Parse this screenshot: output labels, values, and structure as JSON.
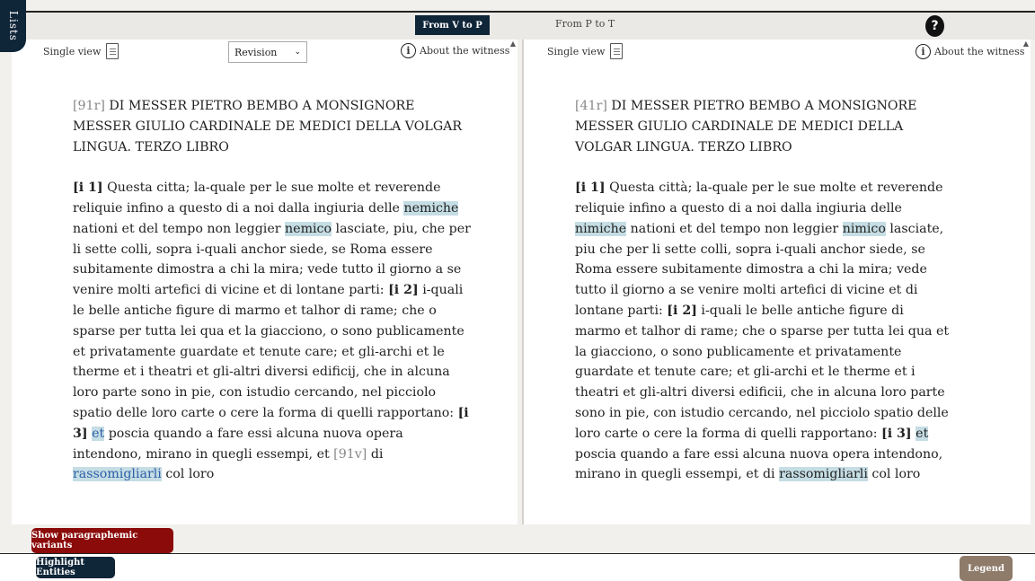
{
  "sidebar": {
    "lists_label": "Lists"
  },
  "header": {
    "tab_v_to_p": "From V to P",
    "tab_p_to_t": "From P to T",
    "help_label": "?"
  },
  "left_panel": {
    "single_view_label": "Single view",
    "revision_value": "Revision",
    "about_label": "About the witness",
    "text": {
      "folio_1": "[91r]",
      "title": " DI MESSER PIETRO BEMBO A MONSIGNORE MESSER GIULIO CARDINALE DE MEDICI DELLA VOLGAR LINGUA. TERZO LIBRO",
      "ref_1": "[i 1]",
      "seg_1": " Questa citta; la-quale per le sue molte et reverende reliquie infino a questo di a noi dalla ingiuria delle ",
      "var_1": "nemiche",
      "seg_2": " nationi et del tempo non leggier ",
      "var_2": "nemico",
      "seg_3": " lasciate, piu, che per li sette colli, sopra i-quali anchor siede, se Roma essere subitamente dimostra a chi la mira; vede tutto il giorno a se venire molti artefici di vicine et di lontane parti: ",
      "ref_2": "[i 2]",
      "seg_4": " i-quali le belle antiche figure di marmo et talhor di rame; che o sparse per tutta lei qua et la giacciono, o sono publicamente et privatamente guardate et tenute care; et gli-archi et le therme et i theatri et gli-altri diversi edificij, che in alcuna loro parte sono in pie, con istudio cercando, nel picciolo spatio delle loro carte o cere la forma di quelli rapportano: ",
      "ref_3": "[i 3]",
      "var_3": "et",
      "seg_5": " poscia quando a fare essi alcuna nuova opera intendono, mirano in quegli essempi, et ",
      "folio_2": "[91v]",
      "seg_6": " di ",
      "var_4": "rassomigliarli",
      "seg_7": " col loro"
    }
  },
  "right_panel": {
    "single_view_label": "Single view",
    "about_label": "About the witness",
    "text": {
      "folio_1": "[41r]",
      "title": " DI MESSER PIETRO BEMBO A MONSIGNORE MESSER GIULIO CARDINALE DE MEDICI DELLA VOLGAR LINGUA. TERZO LIBRO",
      "ref_1": "[i 1]",
      "seg_1": " Questa città; la-quale per le sue molte et reverende reliquie infino a questo di a noi dalla ingiuria delle ",
      "var_1": "nimiche",
      "seg_2": " nationi et del tempo non leggier ",
      "var_2": "nimico",
      "seg_3": " lasciate, piu che per li sette colli, sopra i-quali anchor siede, se Roma essere subitamente dimostra a chi la mira; vede tutto il giorno a se venire molti artefici di vicine et di lontane parti: ",
      "ref_2": "[i 2]",
      "seg_4": " i-quali le belle antiche figure di marmo et talhor di rame; che o sparse per tutta lei qua et la giacciono, o sono publicamente et privatamente guardate et tenute care; et gli-archi et le therme et i theatri et gli-altri diversi edificii, che in alcuna loro parte sono in pie, con istudio cercando, nel picciolo spatio delle loro carte o cere la forma di quelli rapportano: ",
      "ref_3": "[i 3]",
      "var_3": "et",
      "seg_5": " poscia quando a fare essi alcuna nuova opera intendono, mirano in quegli essempi, et di ",
      "var_4": "rassomigliarli",
      "seg_7": " col loro"
    }
  },
  "footer": {
    "paragraphemic_label": "Show paragraphemic variants",
    "entities_label": "Highlight Entities",
    "legend_label": "Legend"
  },
  "colors": {
    "navy": "#0f2538",
    "dark_red": "#8b0b0b",
    "legend_brown": "#8e7b6a",
    "variant_highlight": "#c5dde4"
  }
}
